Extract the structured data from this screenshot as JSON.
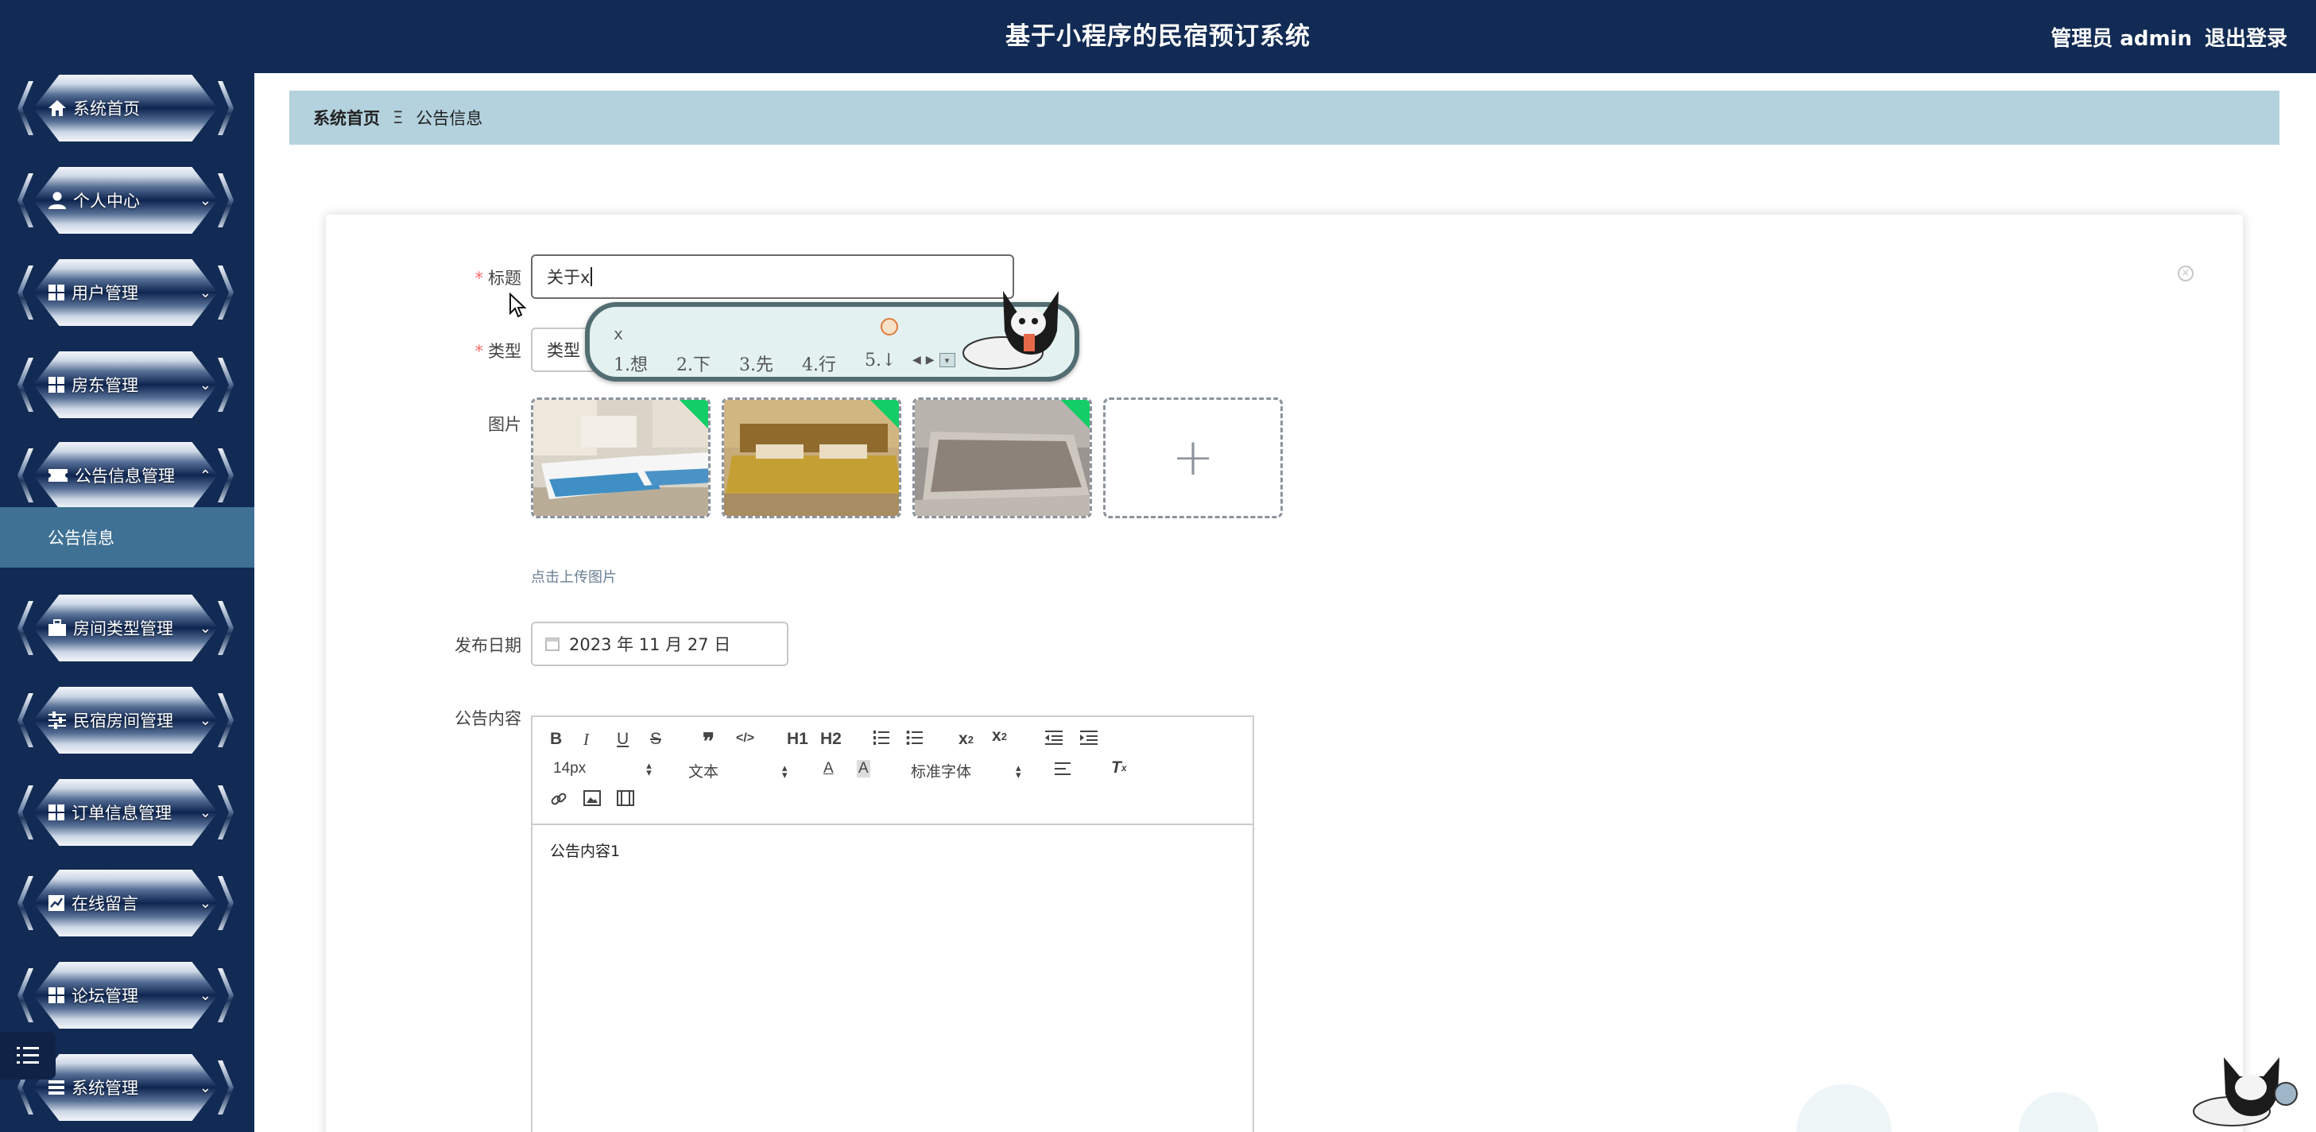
{
  "header": {
    "title": "基于小程序的民宿预订系统",
    "user_label": "管理员 admin",
    "logout": "退出登录"
  },
  "sidebar": {
    "items": [
      {
        "label": "系统首页",
        "icon": "home-icon"
      },
      {
        "label": "个人中心",
        "icon": "user-icon",
        "chevron": "down"
      },
      {
        "label": "用户管理",
        "icon": "grid-icon",
        "chevron": "down"
      },
      {
        "label": "房东管理",
        "icon": "grid-icon",
        "chevron": "down"
      },
      {
        "label": "公告信息管理",
        "icon": "ticket-icon",
        "chevron": "up"
      },
      {
        "label": "房间类型管理",
        "icon": "briefcase-icon",
        "chevron": "down"
      },
      {
        "label": "民宿房间管理",
        "icon": "sliders-icon",
        "chevron": "down"
      },
      {
        "label": "订单信息管理",
        "icon": "grid-icon",
        "chevron": "down"
      },
      {
        "label": "在线留言",
        "icon": "chart-icon",
        "chevron": "down"
      },
      {
        "label": "论坛管理",
        "icon": "grid-icon",
        "chevron": "down"
      },
      {
        "label": "系统管理",
        "icon": "list-icon",
        "chevron": "down"
      }
    ],
    "active_sub": "公告信息"
  },
  "breadcrumb": {
    "home": "系统首页",
    "separator": "Ξ",
    "current": "公告信息"
  },
  "form": {
    "title_label": "标题",
    "title_value": "关于x",
    "type_label": "类型",
    "type_value": "类型",
    "image_label": "图片",
    "upload_tip": "点击上传图片",
    "date_label": "发布日期",
    "date_value": "2023 年 11 月 27 日",
    "content_label": "公告内容",
    "content_value": "公告内容1"
  },
  "editor_toolbar": {
    "font_size": "14px",
    "header_select": "文本",
    "font_family": "标准字体",
    "h1": "H1",
    "h2": "H2"
  },
  "ime": {
    "input": "x",
    "candidates": [
      "1.想",
      "2.下",
      "3.先",
      "4.行",
      "5.↓"
    ]
  },
  "colors": {
    "nav_bg": "#122b54",
    "active_sub_bg": "#3f7195",
    "breadcrumb_bg": "#b3d2de",
    "required": "#f56c6c",
    "upload_success": "#13ce66"
  }
}
